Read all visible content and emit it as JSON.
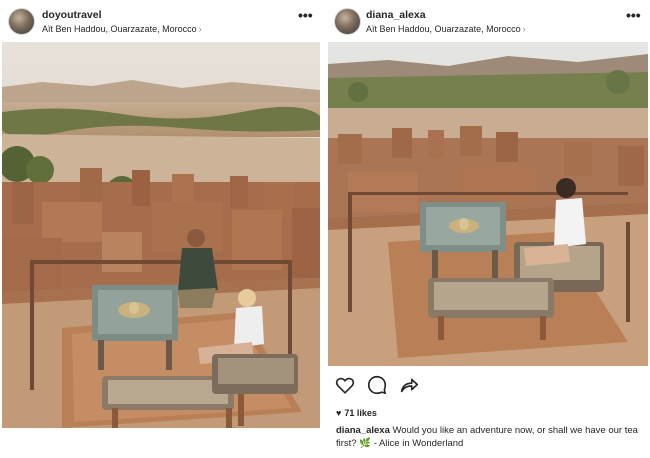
{
  "posts": [
    {
      "username": "doyoutravel",
      "location": "Aït Ben Haddou, Ouarzazate, Morocco",
      "more": "•••"
    },
    {
      "username": "diana_alexa",
      "location": "Aït Ben Haddou, Ouarzazate, Morocco",
      "more": "•••",
      "likes": "71 likes",
      "caption_user": "diana_alexa",
      "caption_text": "Would you like an adventure now, or shall we have our tea first? 🌿 - Alice in Wonderland"
    }
  ],
  "icons": {
    "location_chevron": "›",
    "like": "heart-icon",
    "comment": "comment-icon",
    "share": "share-icon",
    "likes_heart": "♥"
  },
  "colors": {
    "text": "#262626",
    "muted": "#8e8e8e",
    "sky": "#e9e1d6",
    "earth": "#b8805a",
    "mud": "#a9714e",
    "rug": "#c7a27c",
    "greenery": "#5f6b3d"
  }
}
